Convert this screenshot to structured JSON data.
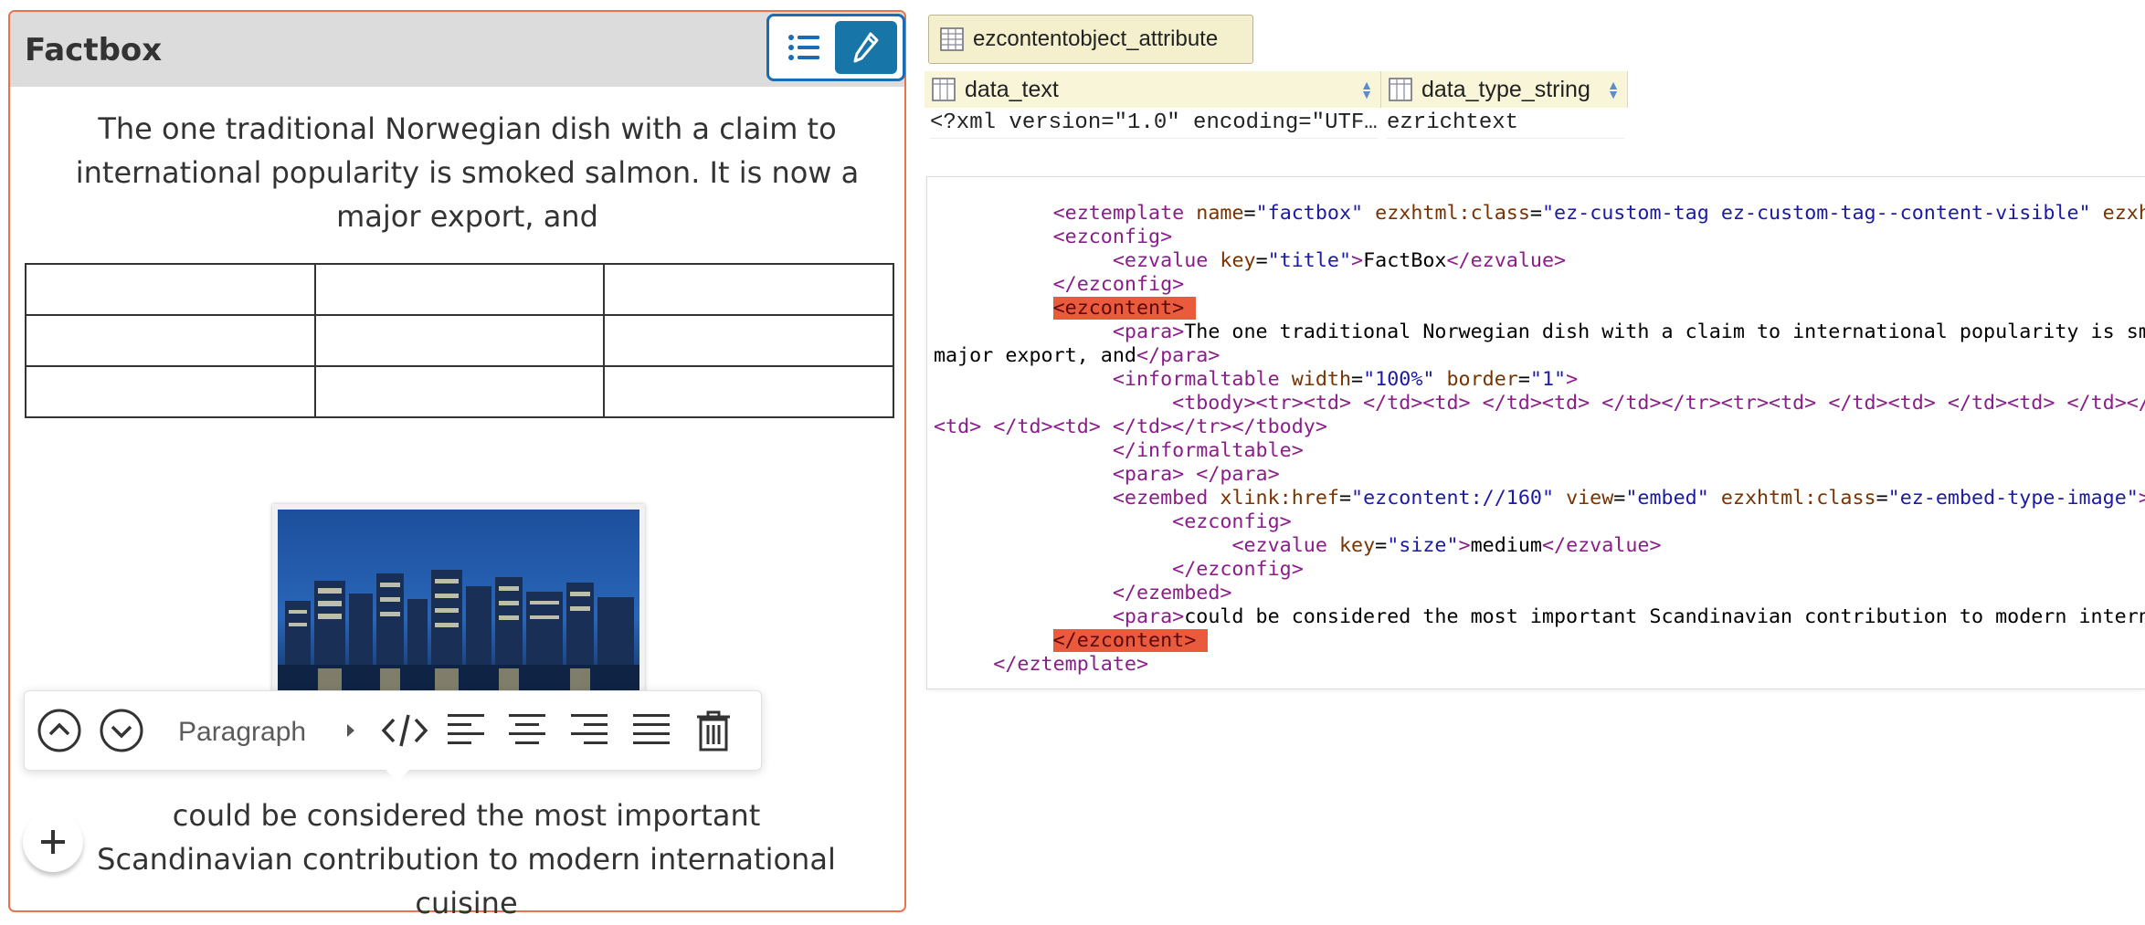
{
  "factbox": {
    "title": "Factbox",
    "para1": "The one traditional Norwegian dish with a claim to international popularity is smoked salmon. It is now a major export, and",
    "para2": "could be considered the most important Scandinavian contribution to modern international cuisine",
    "table": {
      "rows": 3,
      "cols": 3
    },
    "image_desc_icon": "city-skyline-image",
    "toolbar": {
      "style_label": "Paragraph",
      "buttons": [
        "move-up-icon",
        "move-down-icon",
        "style-dropdown-arrow",
        "code-icon",
        "align-left-icon",
        "align-center-icon",
        "align-right-icon",
        "justify-icon",
        "trash-icon"
      ]
    }
  },
  "db": {
    "tab_label": "ezcontentobject_attribute",
    "columns": [
      {
        "label": "data_text",
        "value": "<?xml version=\"1.0\" encoding=\"UTF…"
      },
      {
        "label": "data_type_string",
        "value": "ezrichtext"
      }
    ]
  },
  "colors": {
    "accent_border": "#e8734f",
    "active_blue": "#1875a8",
    "highlight": "#ea5a3d"
  }
}
